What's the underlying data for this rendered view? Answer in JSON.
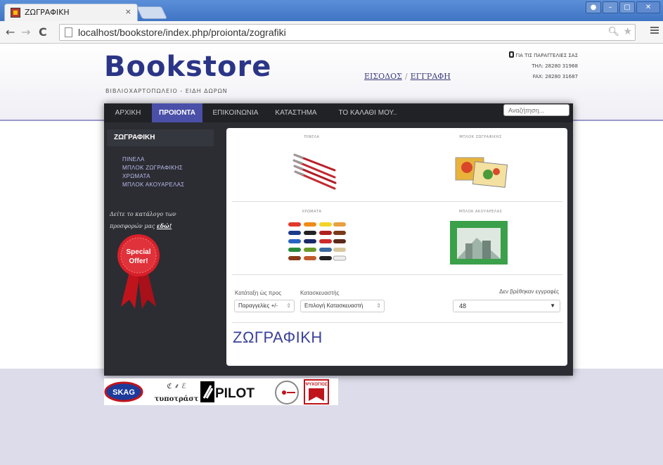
{
  "browser": {
    "tab_title": "ΖΩΓΡΑΦΙΚΗ",
    "tab_close": "×",
    "url": "localhost/bookstore/index.php/proionta/zografiki"
  },
  "site": {
    "logo": "Bookstore",
    "tagline": "ΒΙΒΛΙΟΧΑΡΤΟΠΩΛΕΙΟ - ΕΙΔΗ ΔΩΡΩΝ",
    "login_label": "ΕΙΣΟΔΟΣ",
    "register_label": "ΕΓΓΡΑΦΗ",
    "login_sep": "/",
    "contact_heading": "ΓΙΑ ΤΙΣ ΠΑΡΑΓΓΕΛΙΕΣ ΣΑΣ",
    "phone": "ΤΗΛ: 28280 31968",
    "fax": "FAX: 28280 31687"
  },
  "nav": {
    "items": [
      "ΑΡΧΙΚΗ",
      "ΠΡΟΙΟΝΤΑ",
      "ΕΠΙΚΟΙΝΩΝΙΑ",
      "ΚΑΤΑΣΤΗΜΑ",
      "ΤΟ ΚΑΛΑΘΙ ΜΟΥ.."
    ],
    "active": "ΠΡΟΙΟΝΤΑ",
    "search_placeholder": "Αναζήτηση..."
  },
  "sidebar": {
    "title": "ΖΩΓΡΑΦΙΚΗ",
    "links": [
      "ΠΙΝΕΛΑ",
      "ΜΠΛΟΚ ΖΩΓΡΑΦΙΚΗΣ",
      "ΧΡΩΜΑΤΑ",
      "ΜΠΛΟΚ ΑΚΟΥΑΡΕΛΑΣ"
    ],
    "offer_line1": "Δείτε το κατάλογο των",
    "offer_line2": "προσφορών μας ",
    "offer_link": "εδώ!",
    "badge_line1": "Special",
    "badge_line2": "Offer!"
  },
  "categories": [
    {
      "caption": "ΠΙΝΕΛΑ"
    },
    {
      "caption": "ΜΠΛΟΚ ΖΩΓΡΑΦΙΚΗΣ"
    },
    {
      "caption": "ΧΡΩΜΑΤΑ"
    },
    {
      "caption": "ΜΠΛΟΚ ΑΚΟΥΑΡΕΛΑΣ"
    }
  ],
  "filters": {
    "sort_label": "Κατάταξη ώς προς",
    "sort_value": "Παραγγελίες +/-",
    "manufacturer_label": "Κατασκευαστής",
    "manufacturer_value": "Επιλογή Κατασκευαστή",
    "per_page": "48",
    "no_records": "Δεν βρέθηκαν εγγραφές"
  },
  "page_heading": "ΖΩΓΡΑΦΙΚΗ",
  "brands": [
    "SKAG",
    "τυποτράστ",
    "PILOT",
    "ΨΥΧΟΓΙΟΣ"
  ],
  "colors": {
    "accent": "#4a4fa8",
    "logo": "#2b3587",
    "dark_frame": "#2b2d33"
  }
}
